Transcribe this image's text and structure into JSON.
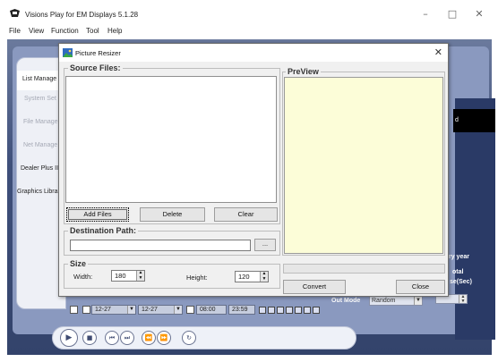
{
  "app": {
    "title": "Visions Play for EM Displays 5.1.28",
    "menu": [
      "File",
      "View",
      "Function",
      "Tool",
      "Help"
    ],
    "window_controls": {
      "minimize": "–",
      "maximize": "□",
      "close": "✕"
    }
  },
  "sidebar": {
    "items": [
      {
        "label": "List Manage",
        "state": "active"
      },
      {
        "label": "System Set",
        "state": "disabled"
      },
      {
        "label": "File Manage",
        "state": "disabled"
      },
      {
        "label": "Net Manage",
        "state": "disabled"
      },
      {
        "label": "Dealer Plus II",
        "state": "normal"
      },
      {
        "label": "Graphics Library",
        "state": "normal"
      }
    ]
  },
  "right_panel": {
    "black_box_text": "d",
    "label1": "ry year",
    "label2": "otal",
    "label3": "se(Sec)",
    "out_mode_label": "Out Mode",
    "out_mode_value": "Random",
    "arrow": "▼"
  },
  "schedule_bar": {
    "start_date": "12-27",
    "end_date": "12-27",
    "start_time": "08:00",
    "end_time": "23:59",
    "day_count": 7
  },
  "player": {
    "buttons": [
      {
        "name": "play-icon",
        "glyph": "▶"
      },
      {
        "name": "stop-icon",
        "glyph": "■"
      },
      {
        "name": "prev-icon",
        "glyph": "⏮"
      },
      {
        "name": "next-icon",
        "glyph": "⏭"
      },
      {
        "name": "rewind-icon",
        "glyph": "⏪"
      },
      {
        "name": "forward-icon",
        "glyph": "⏩"
      },
      {
        "name": "refresh-icon",
        "glyph": "↻"
      }
    ]
  },
  "dialog": {
    "title": "Picture Resizer",
    "close_glyph": "✕",
    "source_files_label": "Source Files:",
    "preview_label": "PreView",
    "add_files": "Add Files",
    "delete": "Delete",
    "clear": "Clear",
    "destination_label": "Destination Path:",
    "destination_value": "",
    "browse": "...",
    "size_label": "Size",
    "width_label": "Width:",
    "width_value": "180",
    "height_label": "Height:",
    "height_value": "120",
    "convert": "Convert",
    "close": "Close"
  },
  "colors": {
    "preview_bg": "#fcfdd8",
    "app_bg": "#3e4f7a",
    "dialog_bg": "#f0f0f0"
  }
}
